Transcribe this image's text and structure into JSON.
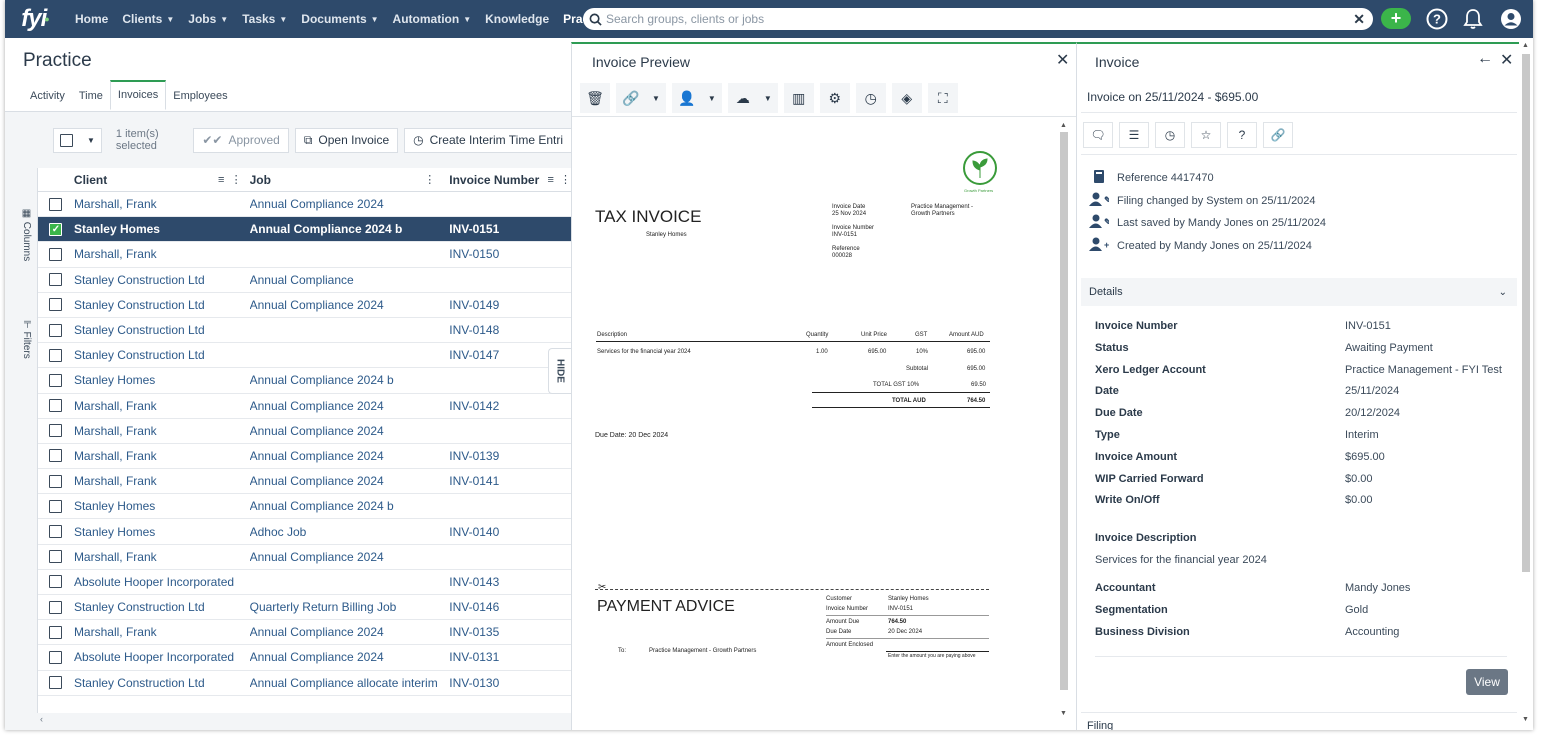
{
  "nav": {
    "logo": "fyi",
    "items": [
      {
        "label": "Home",
        "caret": false
      },
      {
        "label": "Clients",
        "caret": true
      },
      {
        "label": "Jobs",
        "caret": true
      },
      {
        "label": "Tasks",
        "caret": true
      },
      {
        "label": "Documents",
        "caret": true
      },
      {
        "label": "Automation",
        "caret": true
      },
      {
        "label": "Knowledge",
        "caret": false
      },
      {
        "label": "Practice",
        "caret": false,
        "active": true
      }
    ],
    "search_placeholder": "Search groups, clients or jobs"
  },
  "practice": {
    "title": "Practice",
    "tabs": [
      "Activity",
      "Time",
      "Invoices",
      "Employees"
    ],
    "active_tab": "Invoices",
    "toolbar": {
      "selected_info": "1 item(s) selected",
      "approved": "Approved",
      "open_invoice": "Open Invoice",
      "create_interim": "Create Interim Time Entri"
    },
    "side": {
      "columns": "Columns",
      "filters": "Filters"
    },
    "hide_label": "HIDE",
    "columns": {
      "client": "Client",
      "job": "Job",
      "invoice_number": "Invoice Number"
    },
    "rows": [
      {
        "client": "Marshall, Frank",
        "job": "Annual Compliance 2024",
        "invoice": ""
      },
      {
        "client": "Stanley Homes",
        "job": "Annual Compliance 2024 b",
        "invoice": "INV-0151",
        "selected": true
      },
      {
        "client": "Marshall, Frank",
        "job": "",
        "invoice": "INV-0150"
      },
      {
        "client": "Stanley Construction Ltd",
        "job": "Annual Compliance",
        "invoice": ""
      },
      {
        "client": "Stanley Construction Ltd",
        "job": "Annual Compliance 2024",
        "invoice": "INV-0149"
      },
      {
        "client": "Stanley Construction Ltd",
        "job": "",
        "invoice": "INV-0148"
      },
      {
        "client": "Stanley Construction Ltd",
        "job": "",
        "invoice": "INV-0147"
      },
      {
        "client": "Stanley Homes",
        "job": "Annual Compliance 2024 b",
        "invoice": ""
      },
      {
        "client": "Marshall, Frank",
        "job": "Annual Compliance 2024",
        "invoice": "INV-0142"
      },
      {
        "client": "Marshall, Frank",
        "job": "Annual Compliance 2024",
        "invoice": ""
      },
      {
        "client": "Marshall, Frank",
        "job": "Annual Compliance 2024",
        "invoice": "INV-0139"
      },
      {
        "client": "Marshall, Frank",
        "job": "Annual Compliance 2024",
        "invoice": "INV-0141"
      },
      {
        "client": "Stanley Homes",
        "job": "Annual Compliance 2024 b",
        "invoice": ""
      },
      {
        "client": "Stanley Homes",
        "job": "Adhoc Job",
        "invoice": "INV-0140"
      },
      {
        "client": "Marshall, Frank",
        "job": "Annual Compliance 2024",
        "invoice": ""
      },
      {
        "client": "Absolute Hooper Incorporated",
        "job": "",
        "invoice": "INV-0143"
      },
      {
        "client": "Stanley Construction Ltd",
        "job": "Quarterly Return Billing Job",
        "invoice": "INV-0146"
      },
      {
        "client": "Marshall, Frank",
        "job": "Annual Compliance 2024",
        "invoice": "INV-0135"
      },
      {
        "client": "Absolute Hooper Incorporated",
        "job": "Annual Compliance 2024",
        "invoice": "INV-0131"
      },
      {
        "client": "Stanley Construction Ltd",
        "job": "Annual Compliance allocate interim",
        "invoice": "INV-0130"
      }
    ]
  },
  "preview": {
    "title": "Invoice Preview",
    "doc": {
      "logo_text": "Growth Partners",
      "heading": "TAX INVOICE",
      "to_name": "Stanley Homes",
      "invoice_date_label": "Invoice Date",
      "invoice_date": "25 Nov 2024",
      "invoice_number_label": "Invoice Number",
      "invoice_number": "INV-0151",
      "reference_label": "Reference",
      "reference": "000028",
      "from_line1": "Practice Management -",
      "from_line2": "Growth Partners",
      "table_headers": [
        "Description",
        "Quantity",
        "Unit Price",
        "GST",
        "Amount AUD"
      ],
      "line": {
        "description": "Services for the financial year 2024",
        "quantity": "1.00",
        "unit_price": "695.00",
        "gst": "10%",
        "amount": "695.00"
      },
      "subtotal_label": "Subtotal",
      "subtotal": "695.00",
      "gst_label": "TOTAL  GST  10%",
      "gst": "69.50",
      "total_label": "TOTAL AUD",
      "total": "764.50",
      "due_date": "Due Date: 20 Dec 2024",
      "payment_heading": "PAYMENT ADVICE",
      "pa_customer_label": "Customer",
      "pa_customer": "Stanley Homes",
      "pa_invoice_label": "Invoice Number",
      "pa_invoice": "INV-0151",
      "pa_amount_due_label": "Amount Due",
      "pa_amount_due": "764.50",
      "pa_due_date_label": "Due Date",
      "pa_due_date": "20 Dec 2024",
      "pa_enclosed_label": "Amount Enclosed",
      "pa_enclosed_hint": "Enter the amount you are paying above",
      "pa_to_label": "To:",
      "pa_to": "Practice Management - Growth Partners"
    }
  },
  "invoice": {
    "title": "Invoice",
    "subtitle": "Invoice on 25/11/2024 - $695.00",
    "meta": [
      {
        "icon": "book-icon",
        "text": "Reference 4417470"
      },
      {
        "icon": "user-edit-icon",
        "text": "Filing changed by System on 25/11/2024"
      },
      {
        "icon": "user-edit-icon",
        "text": "Last saved by Mandy Jones on 25/11/2024"
      },
      {
        "icon": "user-add-icon",
        "text": "Created by Mandy Jones on 25/11/2024"
      }
    ],
    "details_label": "Details",
    "details": [
      {
        "k": "Invoice Number",
        "v": "INV-0151"
      },
      {
        "k": "Status",
        "v": "Awaiting Payment"
      },
      {
        "k": "Xero Ledger Account",
        "v": "Practice Management - FYI Test"
      },
      {
        "k": "Date",
        "v": "25/11/2024"
      },
      {
        "k": "Due Date",
        "v": "20/12/2024"
      },
      {
        "k": "Type",
        "v": "Interim"
      },
      {
        "k": "Invoice Amount",
        "v": "$695.00"
      },
      {
        "k": "WIP Carried Forward",
        "v": "$0.00"
      },
      {
        "k": "Write On/Off",
        "v": "$0.00"
      }
    ],
    "description_label": "Invoice Description",
    "description": "Services for the financial year  2024",
    "extra": [
      {
        "k": "Accountant",
        "v": "Mandy Jones"
      },
      {
        "k": "Segmentation",
        "v": "Gold"
      },
      {
        "k": "Business Division",
        "v": "Accounting"
      }
    ],
    "view_label": "View",
    "filing_label": "Filing"
  },
  "colors": {
    "nav": "#2e4a6b",
    "accent_green": "#3bb54a",
    "selected_row": "#2e4a6b",
    "link": "#2d5a8a"
  }
}
